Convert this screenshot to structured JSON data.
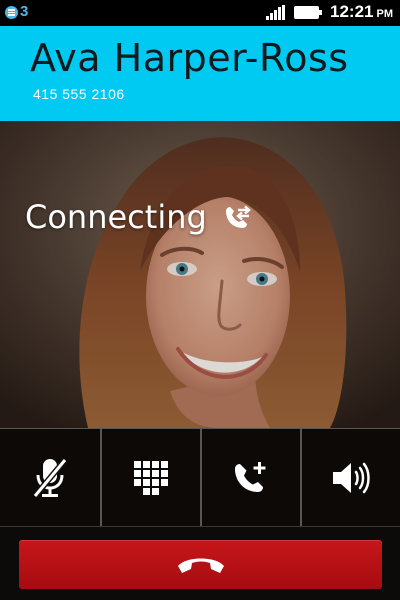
{
  "status_bar": {
    "notification_count": "3",
    "time": "12:21",
    "ampm": "PM",
    "icons": {
      "notification": "notification-icon",
      "signal": "signal-strength-icon",
      "battery": "battery-icon"
    }
  },
  "call": {
    "contact_name": "Ava Harper-Ross",
    "phone_number": "415 555 2106",
    "status": "Connecting",
    "status_icon": "outgoing-call-icon"
  },
  "actions": [
    {
      "id": "mute",
      "icon": "mic-muted-icon"
    },
    {
      "id": "keypad",
      "icon": "keypad-icon"
    },
    {
      "id": "add-call",
      "icon": "add-call-icon"
    },
    {
      "id": "speaker",
      "icon": "speaker-icon"
    }
  ],
  "hangup": {
    "icon": "hang-up-icon"
  },
  "colors": {
    "header_bg": "#00caf2",
    "hangup": "#b5121b",
    "accent": "#4cb8e6"
  }
}
